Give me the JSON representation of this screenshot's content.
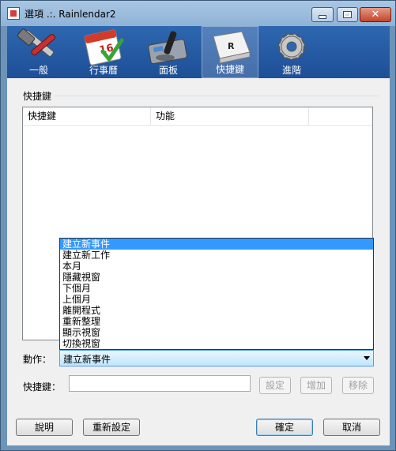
{
  "window": {
    "title": "選項 .:. Rainlendar2",
    "icon": "rainlendar-app-icon"
  },
  "titlebar_buttons": {
    "minimize": "minimize-icon",
    "maximize": "maximize-icon",
    "close": "✕"
  },
  "toolbar": [
    {
      "label": "一般",
      "icon": "tools-icon"
    },
    {
      "label": "行事曆",
      "icon": "calendar-icon",
      "badge": "16"
    },
    {
      "label": "面板",
      "icon": "skins-icon"
    },
    {
      "label": "快捷鍵",
      "icon": "keyboard-icon",
      "keycap": "R"
    },
    {
      "label": "進階",
      "icon": "gear-icon"
    }
  ],
  "group": {
    "label": "快捷鍵"
  },
  "listview": {
    "columns": [
      "快捷鍵",
      "功能"
    ]
  },
  "dropdown": {
    "options": [
      "建立新事件",
      "建立新工作",
      "本月",
      "隱藏視窗",
      "下個月",
      "上個月",
      "離開程式",
      "重新整理",
      "顯示視窗",
      "切換視窗"
    ],
    "selected_index": 0
  },
  "action": {
    "label": "動作：",
    "value": "建立新事件"
  },
  "shortcut": {
    "label": "快捷鍵：",
    "value": ""
  },
  "buttons": {
    "set": "設定",
    "add": "增加",
    "remove": "移除",
    "help": "說明",
    "reset": "重新設定",
    "ok": "確定",
    "cancel": "取消"
  },
  "colors": {
    "toolbar": "#2e67b0",
    "selection": "#3399ff"
  }
}
